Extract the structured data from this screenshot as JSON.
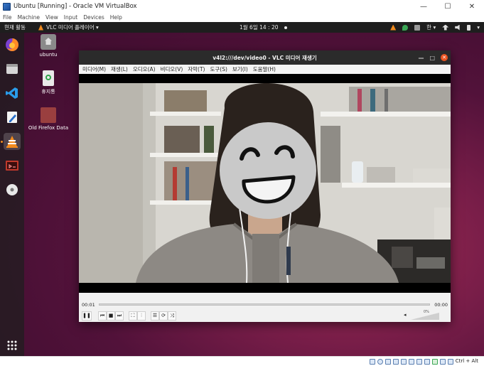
{
  "host": {
    "title": "Ubuntu [Running] - Oracle VM VirtualBox",
    "menu": [
      "File",
      "Machine",
      "View",
      "Input",
      "Devices",
      "Help"
    ],
    "status_key": "Ctrl + Alt"
  },
  "guest": {
    "topbar": {
      "activities": "현재 활동",
      "app_menu": "VLC 미디어 플레이어 ▾",
      "clock": "1월 6일  14 : 20",
      "lang": "한 ▾"
    },
    "desktop_icons": [
      {
        "label": "ubuntu"
      },
      {
        "label": "휴지통"
      },
      {
        "label": "Old Firefox Data"
      }
    ]
  },
  "vlc": {
    "title": "v4l2:///dev/video0 - VLC 미디어 재생기",
    "menu": [
      "미디어(M)",
      "재생(L)",
      "오디오(A)",
      "비디오(V)",
      "자막(T)",
      "도구(S)",
      "보기(I)",
      "도움말(H)"
    ],
    "time_elapsed": "00:01",
    "time_total": "00:00",
    "progress": 0.0,
    "volume_label": "0%"
  },
  "colors": {
    "ubuntu_orange": "#e95420",
    "vlc_orange": "#f28b1e",
    "seek_blue": "#3d7bd9"
  }
}
